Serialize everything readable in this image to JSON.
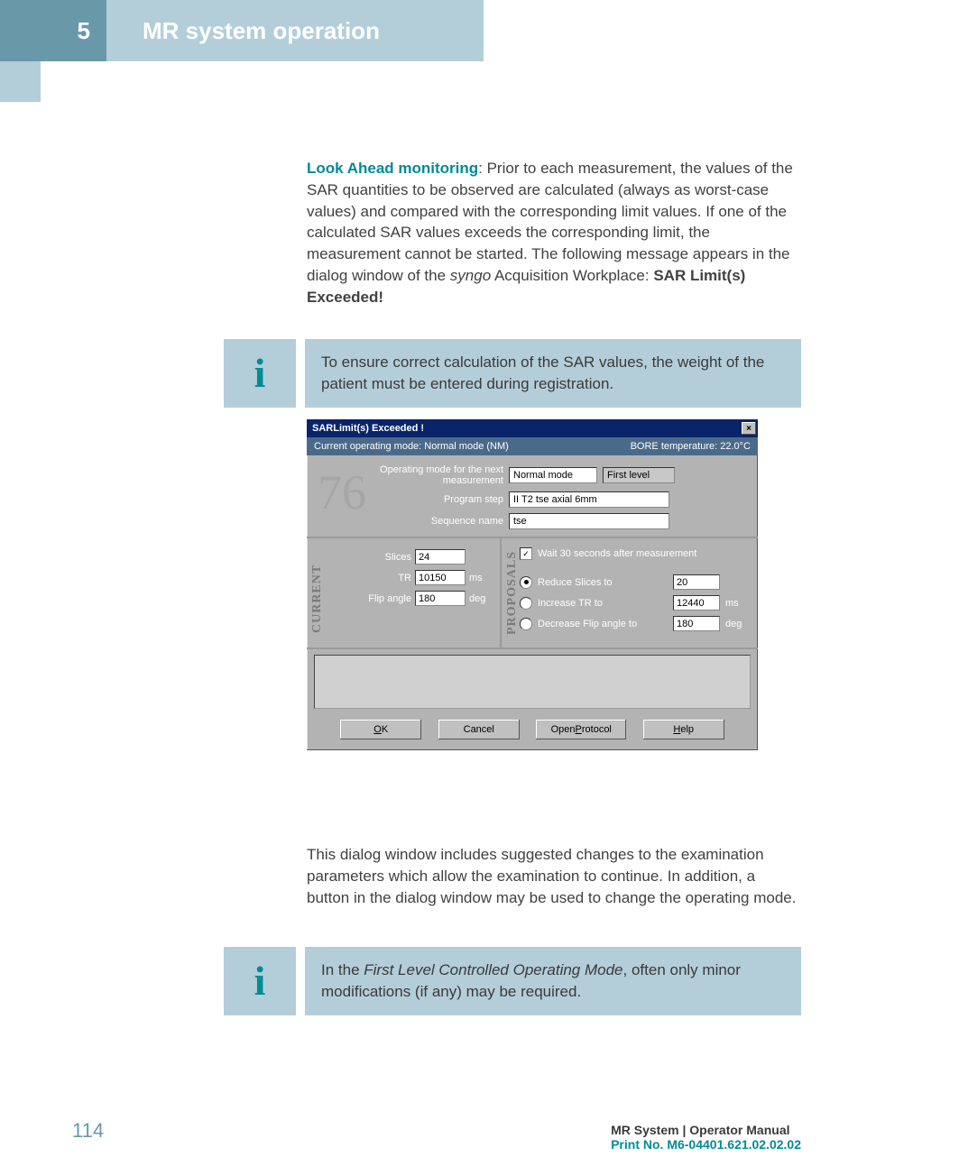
{
  "header": {
    "chapter_number": "5",
    "chapter_title": "MR system operation"
  },
  "body": {
    "lead_in_bold": "Look Ahead monitoring",
    "lead_in_rest": ": Prior to each measurement, the values of the SAR quantities to be observed are calculated (always as worst-case values) and compared with the corresponding limit values. If one of the calculated SAR values exceeds the corresponding limit, the measurement cannot be started. The following message appears in the dialog window of the ",
    "syngo_word": "syngo",
    "after_syngo": " Acquisition Workplace: ",
    "sar_exceeded": "SAR Limit(s) Exceeded!"
  },
  "info1": {
    "glyph": "i",
    "text": "To ensure correct calculation of the SAR values, the weight of the patient must be entered during registration."
  },
  "dialog": {
    "title": "SARLimit(s) Exceeded !",
    "close_glyph": "×",
    "status_left": "Current operating mode: Normal mode (NM)",
    "status_right": "BORE temperature: 22.0°C",
    "ghost": "76",
    "op_label": "Operating mode for the next measurement",
    "op_normal": "Normal mode",
    "op_first": "First level",
    "prog_label": "Program step",
    "prog_val": "II T2 tse axial 6mm",
    "seq_label": "Sequence name",
    "seq_val": "tse",
    "current_header": "CURRENT",
    "proposals_header": "PROPOSALS",
    "slices_label": "Slices",
    "slices_val": "24",
    "tr_label": "TR",
    "tr_val": "10150",
    "tr_unit": "ms",
    "flip_label": "Flip angle",
    "flip_val": "180",
    "flip_unit": "deg",
    "wait_label": "Wait 30 seconds after measurement",
    "reduce_label": "Reduce Slices to",
    "reduce_val": "20",
    "increase_label": "Increase TR to",
    "increase_val": "12440",
    "increase_unit": "ms",
    "decrease_label": "Decrease Flip angle to",
    "decrease_val": "180",
    "decrease_unit": "deg",
    "btn_ok": "OK",
    "btn_cancel": "Cancel",
    "btn_protocol": "Open Protocol",
    "btn_help": "Help"
  },
  "below1": "This dialog window includes suggested changes to the examination parameters which allow the examination to continue. In addition, a button in the dialog window may be used to change the operating mode.",
  "info2": {
    "glyph": "i",
    "pre": "In the ",
    "italic": "First Level Controlled Operating Mode",
    "post": ", often only minor modifications (if any) may be required."
  },
  "footer": {
    "page": "114",
    "right_line1": "MR System | Operator Manual",
    "right_line2": "Print No. M6-04401.621.02.02.02"
  }
}
